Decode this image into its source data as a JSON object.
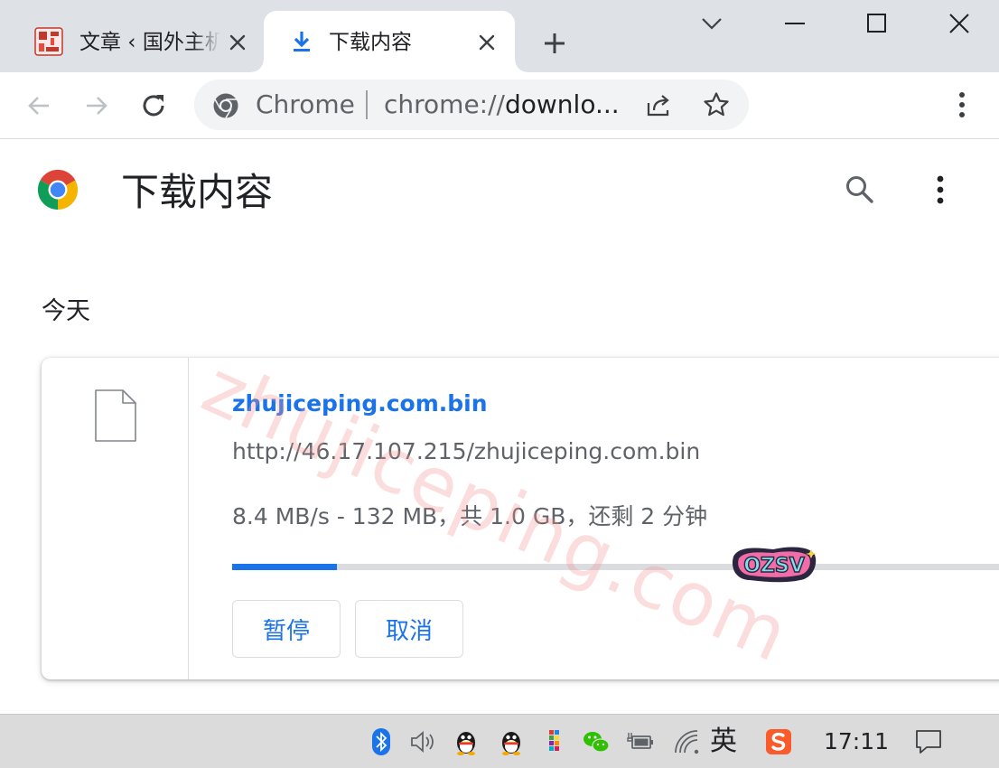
{
  "tabs": [
    {
      "title": "文章 ‹ 国外主机测评",
      "active": false
    },
    {
      "title": "下载内容",
      "active": true
    }
  ],
  "omnibox": {
    "origin_label": "Chrome",
    "url_scheme": "chrome://",
    "url_rest": "downlo..."
  },
  "page": {
    "title": "下载内容",
    "section_date": "今天"
  },
  "watermark": "zhujiceping.com",
  "download": {
    "file_name": "zhujiceping.com.bin",
    "url": "http://46.17.107.215/zhujiceping.com.bin",
    "status": "8.4 MB/s - 132 MB，共 1.0 GB，还剩 2 分钟",
    "progress_fraction": 0.132,
    "pause_label": "暂停",
    "cancel_label": "取消"
  },
  "sticker_text": "OZSV",
  "taskbar": {
    "ime_label": "英",
    "time": "17:11"
  },
  "colors": {
    "accent": "#1a73e8",
    "tab_strip": "#dee1e6",
    "taskbar": "#dbdbdb",
    "watermark": "#f29696"
  }
}
